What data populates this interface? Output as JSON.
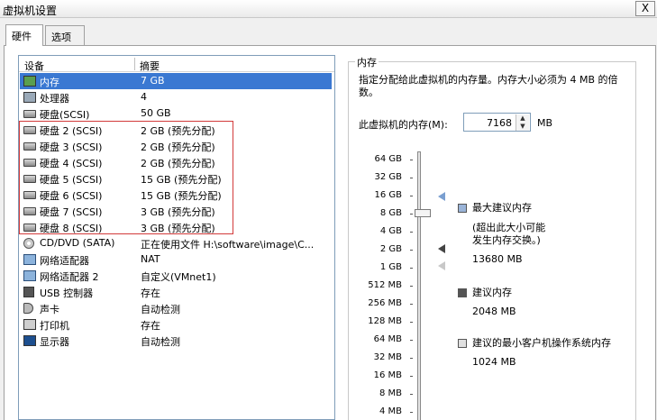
{
  "window": {
    "title": "虚拟机设置",
    "close_label": "X"
  },
  "tabs": [
    {
      "label": "硬件"
    },
    {
      "label": "选项"
    }
  ],
  "device_list": {
    "col_device": "设备",
    "col_summary": "摘要",
    "rows": [
      {
        "name": "内存",
        "summary": "7 GB",
        "icon": "memory-icon"
      },
      {
        "name": "处理器",
        "summary": "4",
        "icon": "processor-icon"
      },
      {
        "name": "硬盘(SCSI)",
        "summary": "50 GB",
        "icon": "hard-disk-icon"
      },
      {
        "name": "硬盘 2 (SCSI)",
        "summary": "2 GB (预先分配)",
        "icon": "hard-disk-icon"
      },
      {
        "name": "硬盘 3 (SCSI)",
        "summary": "2 GB (预先分配)",
        "icon": "hard-disk-icon"
      },
      {
        "name": "硬盘 4 (SCSI)",
        "summary": "2 GB (预先分配)",
        "icon": "hard-disk-icon"
      },
      {
        "name": "硬盘 5 (SCSI)",
        "summary": "15 GB (预先分配)",
        "icon": "hard-disk-icon"
      },
      {
        "name": "硬盘 6 (SCSI)",
        "summary": "15 GB (预先分配)",
        "icon": "hard-disk-icon"
      },
      {
        "name": "硬盘 7 (SCSI)",
        "summary": "3 GB (预先分配)",
        "icon": "hard-disk-icon"
      },
      {
        "name": "硬盘 8 (SCSI)",
        "summary": "3 GB (预先分配)",
        "icon": "hard-disk-icon"
      },
      {
        "name": "CD/DVD (SATA)",
        "summary": "正在使用文件 H:\\software\\image\\C...",
        "icon": "cd-dvd-icon"
      },
      {
        "name": "网络适配器",
        "summary": "NAT",
        "icon": "network-adapter-icon"
      },
      {
        "name": "网络适配器 2",
        "summary": "自定义(VMnet1)",
        "icon": "network-adapter-icon"
      },
      {
        "name": "USB 控制器",
        "summary": "存在",
        "icon": "usb-icon"
      },
      {
        "name": "声卡",
        "summary": "自动检测",
        "icon": "sound-card-icon"
      },
      {
        "name": "打印机",
        "summary": "存在",
        "icon": "printer-icon"
      },
      {
        "name": "显示器",
        "summary": "自动检测",
        "icon": "display-icon"
      }
    ]
  },
  "memory": {
    "group_title": "内存",
    "description": "指定分配给此虚拟机的内存量。内存大小必须为 4 MB 的倍数。",
    "field_label": "此虚拟机的内存(M):",
    "value": "7168",
    "unit": "MB",
    "scale": [
      "64 GB",
      "32 GB",
      "16 GB",
      "8 GB",
      "4 GB",
      "2 GB",
      "1 GB",
      "512 MB",
      "256 MB",
      "128 MB",
      "64 MB",
      "32 MB",
      "16 MB",
      "8 MB",
      "4 MB"
    ],
    "legend": {
      "max_title": "最大建议内存",
      "max_note_1": "(超出此大小可能",
      "max_note_2": "发生内存交换。)",
      "max_value": "13680 MB",
      "rec_title": "建议内存",
      "rec_value": "2048 MB",
      "min_title": "建议的最小客户机操作系统内存",
      "min_value": "1024 MB"
    }
  }
}
